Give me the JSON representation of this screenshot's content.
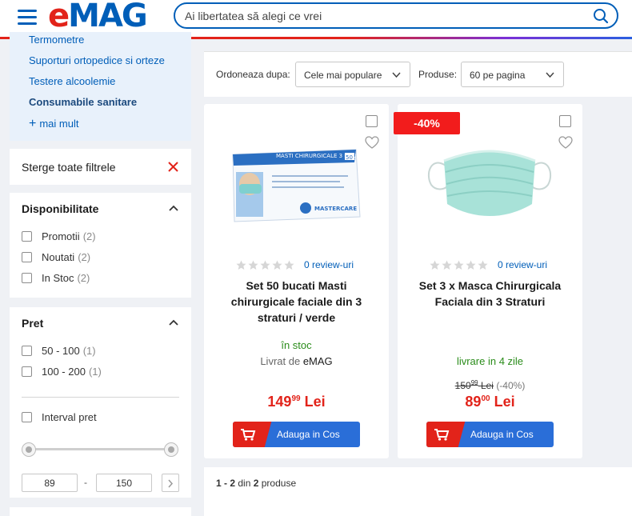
{
  "header": {
    "logo_e": "e",
    "logo_mag": "MAG",
    "search_placeholder": "Ai libertatea să alegi ce vrei"
  },
  "sidebar": {
    "categories": [
      {
        "label": "Termometre"
      },
      {
        "label": "Suporturi ortopedice si orteze"
      },
      {
        "label": "Testere alcoolemie"
      },
      {
        "label": "Consumabile sanitare",
        "active": true
      }
    ],
    "more_label": "mai mult",
    "clear_filters": "Sterge toate filtrele",
    "availability": {
      "title": "Disponibilitate",
      "options": [
        {
          "label": "Promotii",
          "count": "(2)"
        },
        {
          "label": "Noutati",
          "count": "(2)"
        },
        {
          "label": "In Stoc",
          "count": "(2)"
        }
      ]
    },
    "price": {
      "title": "Pret",
      "options": [
        {
          "label": "50 - 100",
          "count": "(1)"
        },
        {
          "label": "100 - 200",
          "count": "(1)"
        }
      ],
      "interval_label": "Interval pret",
      "min": "89",
      "max": "150",
      "separator": "-"
    }
  },
  "toolbar": {
    "sort_label": "Ordoneaza dupa:",
    "sort_value": "Cele mai populare",
    "per_page_label": "Produse:",
    "per_page_value": "60 pe pagina"
  },
  "products": [
    {
      "title": "Set 50 bucati Masti chirurgicale faciale din 3 straturi / verde",
      "reviews": "0 review-uri",
      "availability": "în stoc",
      "seller_prefix": "Livrat de",
      "seller": "eMAG",
      "price_int": "149",
      "price_dec": "99",
      "currency": "Lei",
      "button": "Adauga in Cos",
      "box_text": "MASTI CHIRURGICALE 3 PLIURI CU SIRET",
      "brand": "MASTERCARE",
      "box_count": "50"
    },
    {
      "title": "Set 3 x Masca Chirurgicala Faciala din 3 Straturi",
      "reviews": "0 review-uri",
      "badge": "-40%",
      "availability": "livrare in 4 zile",
      "old_price_int": "150",
      "old_price_dec": "99",
      "old_currency": "Lei",
      "discount": "(-40%)",
      "price_int": "89",
      "price_dec": "00",
      "currency": "Lei",
      "button": "Adauga in Cos"
    }
  ],
  "pager": {
    "range": "1 - 2",
    "of": "din",
    "total": "2",
    "suffix": "produse"
  },
  "colors": {
    "brand_blue": "#005eb8",
    "brand_red": "#e2231a",
    "stock_green": "#2a8c1a",
    "button_blue": "#2a6ed8"
  }
}
